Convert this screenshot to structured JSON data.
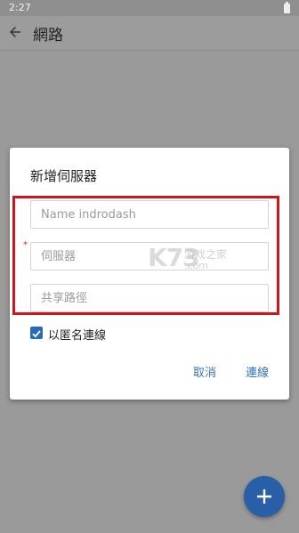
{
  "status_bar": {
    "time": "2:27",
    "battery_icon": "battery-icon"
  },
  "app_bar": {
    "back_icon": "back-arrow-icon",
    "title": "網路"
  },
  "dialog": {
    "title": "新增伺服器",
    "fields": {
      "name": {
        "value": "",
        "placeholder": "Name indrodash"
      },
      "server": {
        "value": "",
        "placeholder": "伺服器",
        "required_mark": "*"
      },
      "share_path": {
        "value": "",
        "placeholder": "共享路徑"
      }
    },
    "anonymous": {
      "label": "以匿名連線",
      "checked": true
    },
    "buttons": {
      "cancel": "取消",
      "connect": "連線"
    },
    "watermark": {
      "logo": "K73",
      "site_cn": "游戏之家",
      "site_com": ".com"
    }
  },
  "fab": {
    "icon": "plus-icon"
  },
  "colors": {
    "accent": "#2f6fc0",
    "highlight": "#d0141b",
    "overlay": "#9a9a9a"
  }
}
